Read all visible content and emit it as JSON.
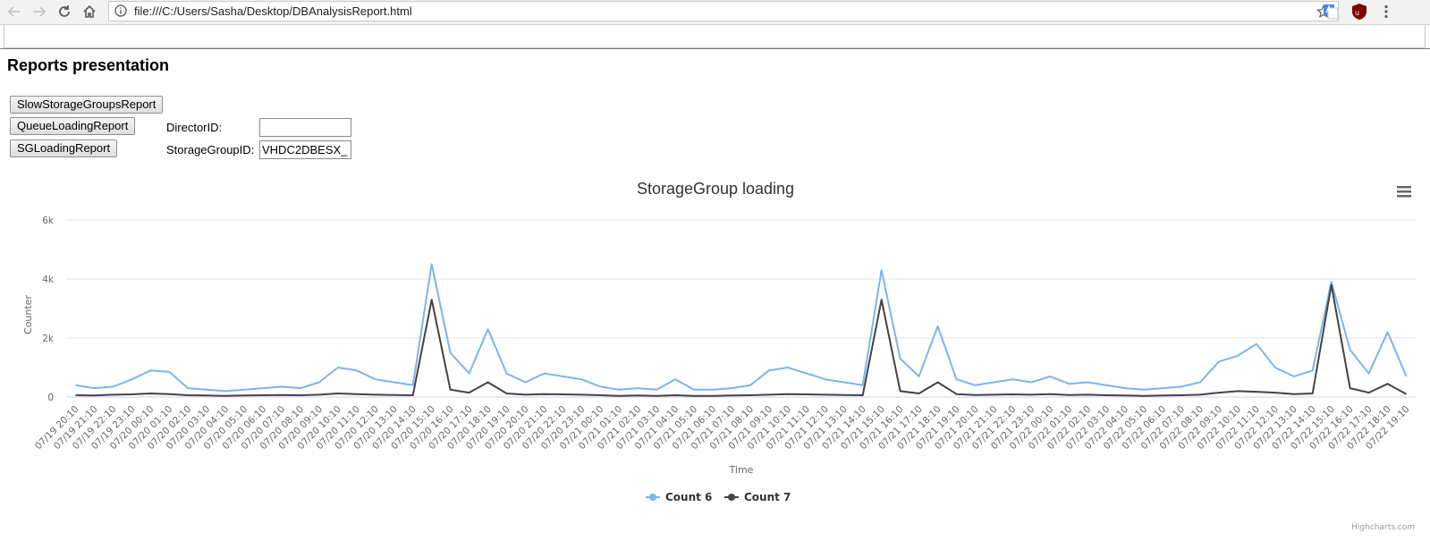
{
  "browser": {
    "url": "file:///C:/Users/Sasha/Desktop/DBAnalysisReport.html"
  },
  "page": {
    "title": "Reports presentation",
    "buttons": {
      "slow_storage": "SlowStorageGroupsReport",
      "queue_loading": "QueueLoadingReport",
      "sg_loading": "SGLoadingReport"
    },
    "fields": {
      "director_label": "DirectorID:",
      "director_value": "",
      "storage_label": "StorageGroupID:",
      "storage_value": "VHDC2DBESX_"
    }
  },
  "chart_data": {
    "type": "line",
    "title": "StorageGroup loading",
    "xlabel": "Time",
    "ylabel": "Counter",
    "ylim": [
      0,
      6000
    ],
    "yticks": [
      "0",
      "2k",
      "4k",
      "6k"
    ],
    "grid": true,
    "legend_position": "bottom-center",
    "credits": "Highcharts.com",
    "categories": [
      "07/19 20:10",
      "07/19 21:10",
      "07/19 22:10",
      "07/19 23:10",
      "07/20 00:10",
      "07/20 01:10",
      "07/20 02:10",
      "07/20 03:10",
      "07/20 04:10",
      "07/20 05:10",
      "07/20 06:10",
      "07/20 07:10",
      "07/20 08:10",
      "07/20 09:10",
      "07/20 10:10",
      "07/20 11:10",
      "07/20 12:10",
      "07/20 13:10",
      "07/20 14:10",
      "07/20 15:10",
      "07/20 16:10",
      "07/20 17:10",
      "07/20 18:10",
      "07/20 19:10",
      "07/20 20:10",
      "07/20 21:10",
      "07/20 22:10",
      "07/20 23:10",
      "07/21 00:10",
      "07/21 01:10",
      "07/21 02:10",
      "07/21 03:10",
      "07/21 04:10",
      "07/21 05:10",
      "07/21 06:10",
      "07/21 07:10",
      "07/21 08:10",
      "07/21 09:10",
      "07/21 10:10",
      "07/21 11:10",
      "07/21 12:10",
      "07/21 13:10",
      "07/21 14:10",
      "07/21 15:10",
      "07/21 16:10",
      "07/21 17:10",
      "07/21 18:10",
      "07/21 19:10",
      "07/21 20:10",
      "07/21 21:10",
      "07/21 22:10",
      "07/21 23:10",
      "07/22 00:10",
      "07/22 01:10",
      "07/22 02:10",
      "07/22 03:10",
      "07/22 04:10",
      "07/22 05:10",
      "07/22 06:10",
      "07/22 07:10",
      "07/22 08:10",
      "07/22 09:10",
      "07/22 10:10",
      "07/22 11:10",
      "07/22 12:10",
      "07/22 13:10",
      "07/22 14:10",
      "07/22 15:10",
      "07/22 16:10",
      "07/22 17:10",
      "07/22 18:10",
      "07/22 19:10"
    ],
    "series": [
      {
        "name": "Count 6",
        "color": "#7cb5ec",
        "values": [
          400,
          300,
          350,
          600,
          900,
          850,
          300,
          250,
          200,
          250,
          300,
          350,
          300,
          500,
          1000,
          900,
          600,
          500,
          400,
          4500,
          1500,
          800,
          2300,
          800,
          500,
          800,
          700,
          600,
          350,
          250,
          300,
          250,
          600,
          250,
          250,
          300,
          400,
          900,
          1000,
          800,
          600,
          500,
          400,
          4300,
          1300,
          700,
          2400,
          600,
          400,
          500,
          600,
          500,
          700,
          450,
          500,
          400,
          300,
          250,
          300,
          350,
          500,
          1200,
          1400,
          1800,
          1000,
          700,
          900,
          3900,
          1600,
          800,
          2200,
          700
        ]
      },
      {
        "name": "Count 7",
        "color": "#434348",
        "values": [
          60,
          50,
          80,
          90,
          120,
          100,
          60,
          50,
          40,
          50,
          60,
          70,
          60,
          80,
          120,
          100,
          80,
          70,
          60,
          3300,
          250,
          150,
          500,
          120,
          80,
          100,
          90,
          80,
          60,
          40,
          50,
          40,
          60,
          40,
          40,
          50,
          60,
          80,
          100,
          90,
          80,
          70,
          60,
          3300,
          200,
          120,
          500,
          100,
          70,
          80,
          90,
          80,
          100,
          70,
          80,
          60,
          50,
          40,
          50,
          60,
          80,
          150,
          200,
          180,
          150,
          100,
          120,
          3800,
          300,
          150,
          450,
          100
        ]
      }
    ]
  }
}
